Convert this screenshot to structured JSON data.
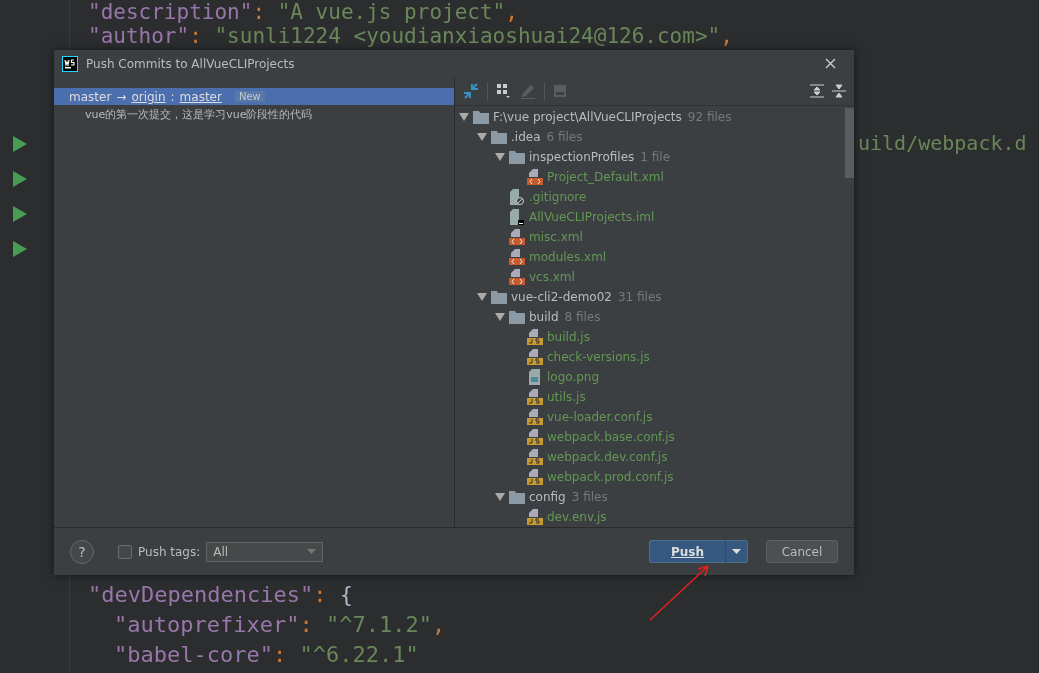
{
  "editor": {
    "top_lines": [
      {
        "tokens": [
          {
            "kind": "key",
            "text": "\"description\""
          },
          {
            "kind": "punct",
            "text": ": "
          },
          {
            "kind": "string",
            "text": "\"A vue.js project\""
          },
          {
            "kind": "punct",
            "text": ","
          }
        ]
      },
      {
        "tokens": [
          {
            "kind": "key",
            "text": "\"author\""
          },
          {
            "kind": "punct",
            "text": ": "
          },
          {
            "kind": "string",
            "text": "\"sunli1224 <youdianxiaoshuai24@126.com>\""
          },
          {
            "kind": "punct",
            "text": ","
          }
        ]
      }
    ],
    "fragment": "uild/webpack.d",
    "bottom_lines": [
      {
        "tokens": [
          {
            "kind": "key",
            "text": "\"devDependencies\""
          },
          {
            "kind": "punct",
            "text": ": "
          },
          {
            "kind": "brace",
            "text": "{"
          }
        ],
        "children": [
          {
            "tokens": [
              {
                "kind": "key",
                "text": "\"autoprefixer\""
              },
              {
                "kind": "punct",
                "text": ": "
              },
              {
                "kind": "string",
                "text": "\"^7.1.2\""
              },
              {
                "kind": "punct",
                "text": ","
              }
            ]
          },
          {
            "tokens": [
              {
                "kind": "key",
                "text": "\"babel-core\""
              },
              {
                "kind": "punct",
                "text": ": "
              },
              {
                "kind": "string",
                "text": "\"^6.22.1\""
              }
            ]
          }
        ]
      }
    ]
  },
  "dialog": {
    "title": "Push Commits to AllVueCLIProjects",
    "branch": {
      "source": "master",
      "arrow": "→",
      "remote": "origin",
      "separator": ":",
      "target": "master",
      "badge": "New",
      "selected": true
    },
    "commits": [
      "vue的第一次提交，这是学习vue阶段性的代码"
    ],
    "tree": [
      {
        "kind": "folder",
        "name": "F:\\vue project\\AllVueCLIProjects",
        "count": "92 files",
        "expanded": true,
        "children": [
          {
            "kind": "folder",
            "name": ".idea",
            "count": "6 files",
            "expanded": true,
            "children": [
              {
                "kind": "folder",
                "name": "inspectionProfiles",
                "count": "1 file",
                "expanded": true,
                "children": [
                  {
                    "kind": "xml",
                    "name": "Project_Default.xml"
                  }
                ]
              },
              {
                "kind": "ignore",
                "name": ".gitignore"
              },
              {
                "kind": "iml",
                "name": "AllVueCLIProjects.iml"
              },
              {
                "kind": "xml",
                "name": "misc.xml"
              },
              {
                "kind": "xml",
                "name": "modules.xml"
              },
              {
                "kind": "xml",
                "name": "vcs.xml"
              }
            ]
          },
          {
            "kind": "folder",
            "name": "vue-cli2-demo02",
            "count": "31 files",
            "expanded": true,
            "children": [
              {
                "kind": "folder",
                "name": "build",
                "count": "8 files",
                "expanded": true,
                "children": [
                  {
                    "kind": "js",
                    "name": "build.js"
                  },
                  {
                    "kind": "js",
                    "name": "check-versions.js"
                  },
                  {
                    "kind": "png",
                    "name": "logo.png"
                  },
                  {
                    "kind": "js",
                    "name": "utils.js"
                  },
                  {
                    "kind": "js",
                    "name": "vue-loader.conf.js"
                  },
                  {
                    "kind": "js",
                    "name": "webpack.base.conf.js"
                  },
                  {
                    "kind": "js",
                    "name": "webpack.dev.conf.js"
                  },
                  {
                    "kind": "js",
                    "name": "webpack.prod.conf.js"
                  }
                ]
              },
              {
                "kind": "folder",
                "name": "config",
                "count": "3 files",
                "expanded": true,
                "children": [
                  {
                    "kind": "js",
                    "name": "dev.env.js"
                  }
                ]
              }
            ]
          }
        ]
      }
    ],
    "push_tags": {
      "label": "Push tags:",
      "checked": false,
      "value": "All"
    },
    "buttons": {
      "help": "?",
      "push": "Push",
      "cancel": "Cancel"
    }
  }
}
